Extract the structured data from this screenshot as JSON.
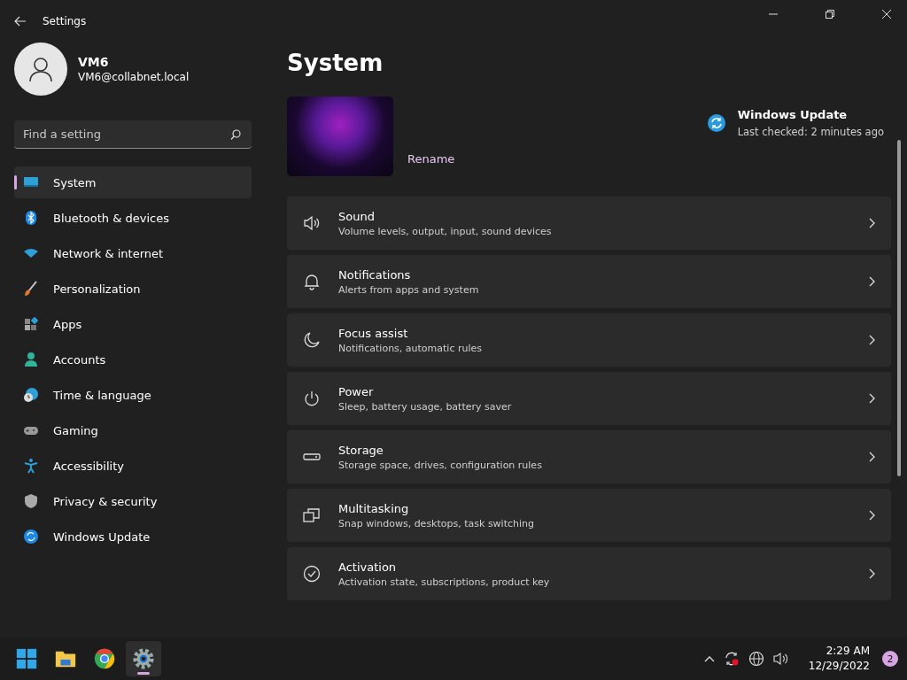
{
  "window": {
    "title": "Settings"
  },
  "user": {
    "name": "VM6",
    "email": "VM6@collabnet.local"
  },
  "search": {
    "placeholder": "Find a setting"
  },
  "sidebar": {
    "items": [
      {
        "label": "System",
        "selected": true
      },
      {
        "label": "Bluetooth & devices",
        "selected": false
      },
      {
        "label": "Network & internet",
        "selected": false
      },
      {
        "label": "Personalization",
        "selected": false
      },
      {
        "label": "Apps",
        "selected": false
      },
      {
        "label": "Accounts",
        "selected": false
      },
      {
        "label": "Time & language",
        "selected": false
      },
      {
        "label": "Gaming",
        "selected": false
      },
      {
        "label": "Accessibility",
        "selected": false
      },
      {
        "label": "Privacy & security",
        "selected": false
      },
      {
        "label": "Windows Update",
        "selected": false
      }
    ]
  },
  "page": {
    "title": "System",
    "rename": "Rename",
    "update": {
      "title": "Windows Update",
      "status": "Last checked: 2 minutes ago"
    }
  },
  "cards": [
    {
      "title": "Sound",
      "subtitle": "Volume levels, output, input, sound devices"
    },
    {
      "title": "Notifications",
      "subtitle": "Alerts from apps and system"
    },
    {
      "title": "Focus assist",
      "subtitle": "Notifications, automatic rules"
    },
    {
      "title": "Power",
      "subtitle": "Sleep, battery usage, battery saver"
    },
    {
      "title": "Storage",
      "subtitle": "Storage space, drives, configuration rules"
    },
    {
      "title": "Multitasking",
      "subtitle": "Snap windows, desktops, task switching"
    },
    {
      "title": "Activation",
      "subtitle": "Activation state, subscriptions, product key"
    }
  ],
  "taskbar": {
    "apps": [
      {
        "selected": false
      },
      {
        "selected": false
      },
      {
        "selected": false
      },
      {
        "selected": true
      }
    ],
    "time": "2:29 AM",
    "date": "12/29/2022",
    "notifications": "2"
  }
}
